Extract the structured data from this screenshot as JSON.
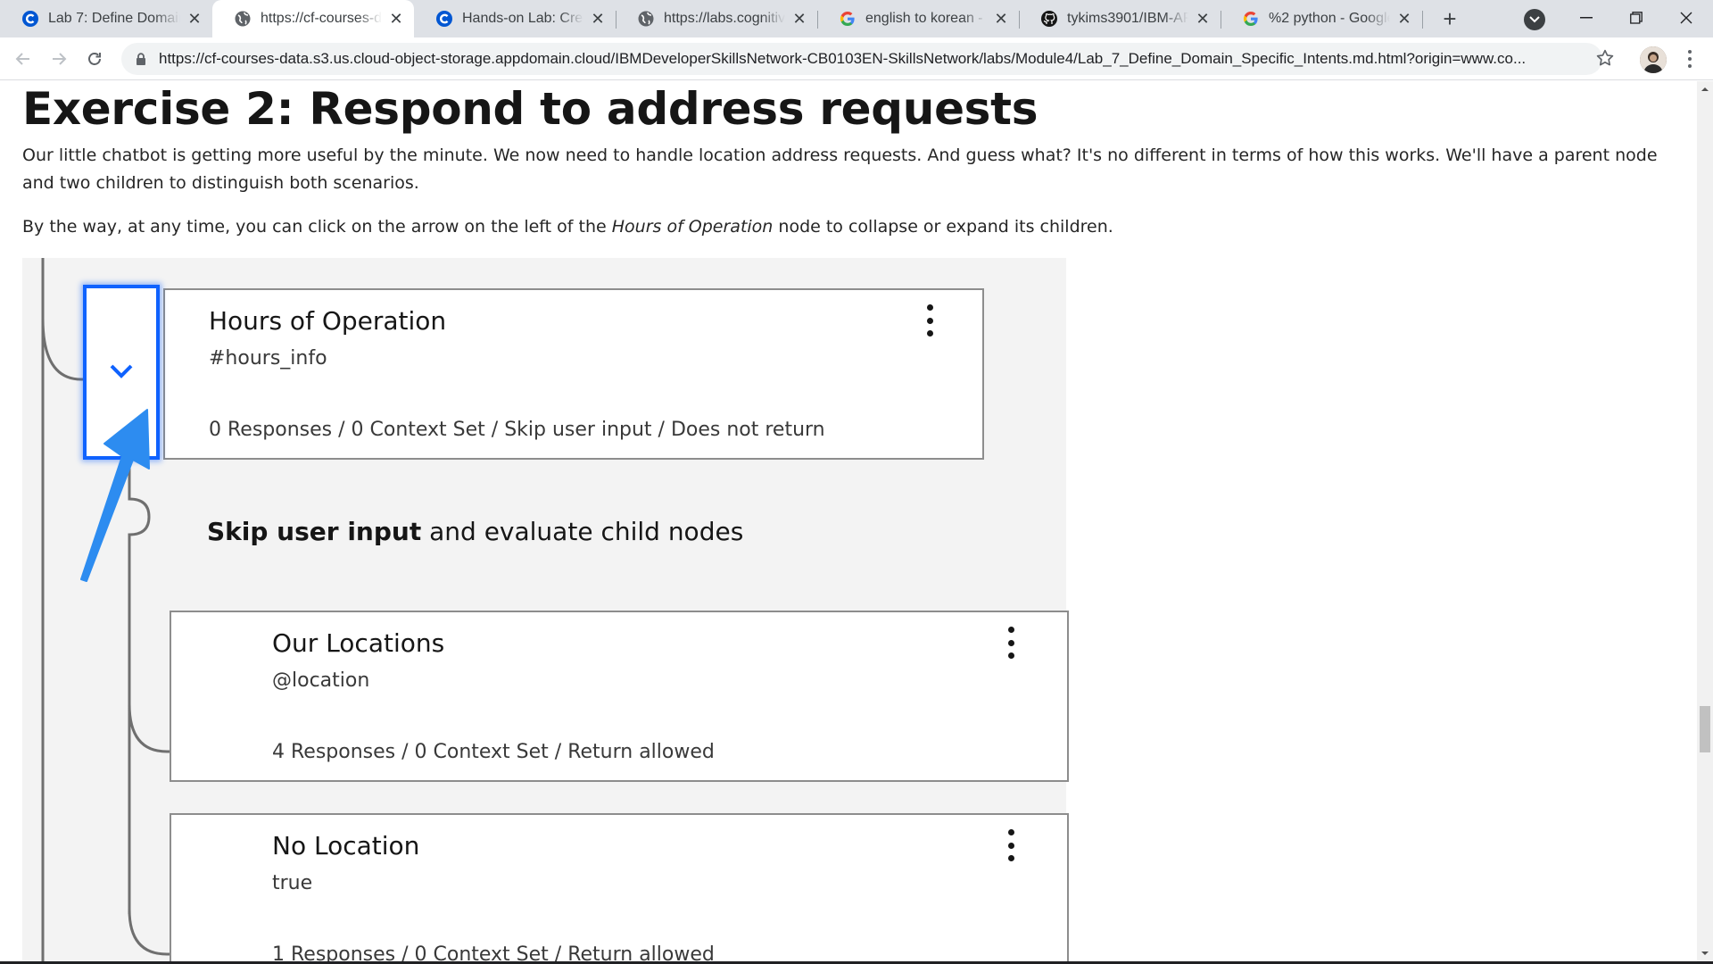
{
  "tabs": [
    {
      "title": "Lab 7: Define Domain",
      "icon": "coursera-icon",
      "active": false
    },
    {
      "title": "https://cf-courses-data",
      "icon": "globe-icon",
      "active": true
    },
    {
      "title": "Hands-on Lab: Creati",
      "icon": "coursera-icon",
      "active": false
    },
    {
      "title": "https://labs.cognitive",
      "icon": "globe-icon",
      "active": false
    },
    {
      "title": "english to korean - G",
      "icon": "google-icon",
      "active": false
    },
    {
      "title": "tykims3901/IBM-APP",
      "icon": "github-icon",
      "active": false
    },
    {
      "title": "%2 python - Google",
      "icon": "google-icon",
      "active": false
    }
  ],
  "toolbar": {
    "url": "https://cf-courses-data.s3.us.cloud-object-storage.appdomain.cloud/IBMDeveloperSkillsNetwork-CB0103EN-SkillsNetwork/labs/Module4/Lab_7_Define_Domain_Specific_Intents.md.html?origin=www.co..."
  },
  "article": {
    "heading": "Exercise 2: Respond to address requests",
    "para1": "Our little chatbot is getting more useful by the minute. We now need to handle location address requests. And guess what? It's no different in terms of how this works. We'll have a parent node and two children to distinguish both scenarios.",
    "para2_pre": "By the way, at any time, you can click on the arrow on the left of the ",
    "para2_em": "Hours of Operation",
    "para2_post": " node to collapse or expand its children."
  },
  "figure": {
    "parent": {
      "title": "Hours of Operation",
      "condition": "#hours_info",
      "summary": "0 Responses / 0 Context Set / Skip user input / Does not return"
    },
    "skip_bold": "Skip user input",
    "skip_rest": " and evaluate child nodes",
    "children": [
      {
        "title": "Our Locations",
        "condition": "@location",
        "summary": "4 Responses / 0 Context Set / Return allowed"
      },
      {
        "title": "No Location",
        "condition": "true",
        "summary": "1 Responses / 0 Context Set / Return allowed"
      }
    ]
  },
  "colors": {
    "accent": "#0f62fe",
    "arrow": "#2d8cf0"
  }
}
